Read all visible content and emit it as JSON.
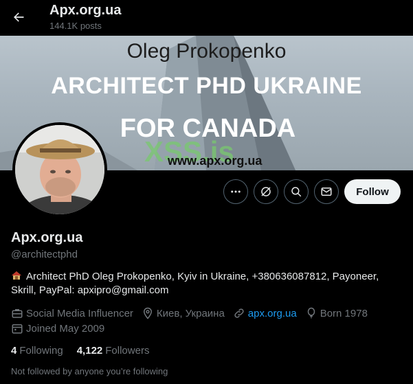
{
  "header": {
    "title": "Apx.org.ua",
    "posts": "144.1K posts"
  },
  "banner": {
    "line1": "Oleg Prokopenko",
    "line2": "ARCHITECT PHD UKRAINE",
    "line3": "FOR CANADA",
    "watermark": "XSS.is",
    "url": "www.apx.org.ua"
  },
  "actions": {
    "follow_label": "Follow"
  },
  "profile": {
    "name": "Apx.org.ua",
    "handle": "@architectphd",
    "bio": "Architect PhD Oleg Prokopenko, Kyiv in Ukraine, +380636087812, Payoneer, Skrill, PayPal: apxipro@gmail.com"
  },
  "meta": {
    "category": "Social Media Influencer",
    "location": "Киев, Украина",
    "website": "apx.org.ua",
    "birth": "Born 1978",
    "joined": "Joined May 2009"
  },
  "stats": {
    "following_count": "4",
    "following_label": "Following",
    "followers_count": "4,122",
    "followers_label": "Followers"
  },
  "social_context": "Not followed by anyone you’re following",
  "colors": {
    "background": "#000000",
    "link": "#1d9bf0",
    "secondary_text": "#71767b",
    "primary_text": "#e7e9ea"
  }
}
